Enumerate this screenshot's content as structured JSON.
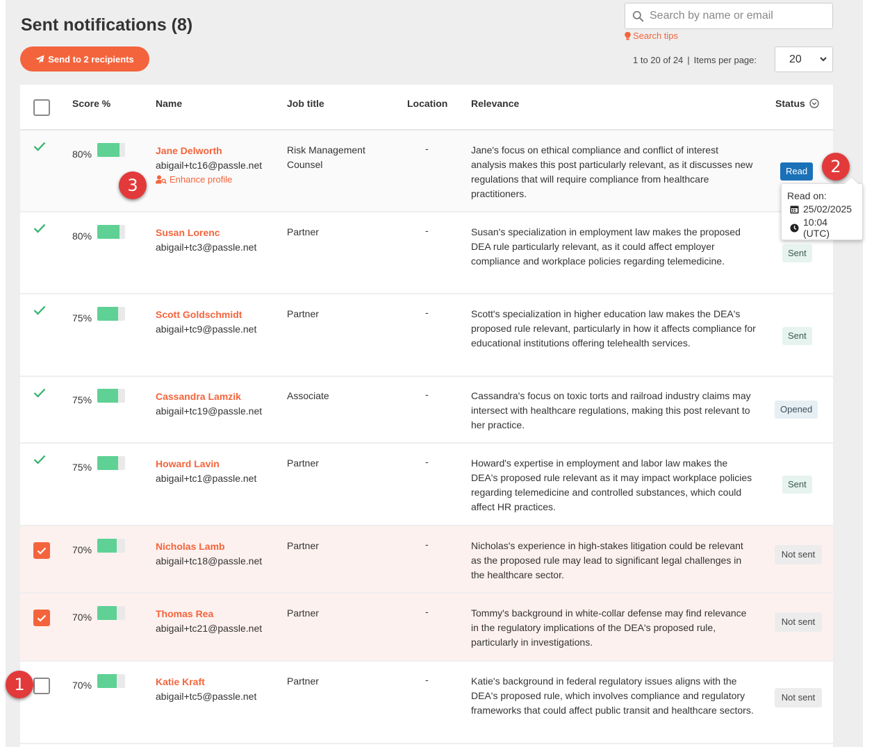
{
  "header": {
    "title": "Sent notifications (8)",
    "send_button": "Send to 2 recipients"
  },
  "search": {
    "placeholder": "Search by name or email",
    "tips": "Search tips"
  },
  "pagination": {
    "range": "1 to 20 of 24",
    "separator": "|",
    "items_per_page_label": "Items per page:",
    "items_per_page": "20"
  },
  "columns": {
    "score": "Score %",
    "name": "Name",
    "job": "Job title",
    "location": "Location",
    "relevance": "Relevance",
    "status": "Status"
  },
  "rows": [
    {
      "score": "80%",
      "score_fill": 0.8,
      "name": "Jane Delworth",
      "email": "abigail+tc16@passle.net",
      "job": "Risk Management Counsel",
      "location": "-",
      "relevance": "Jane's focus on ethical compliance and conflict of interest analysis makes this post particularly relevant, as it discusses new regulations that will require compliance from healthcare practitioners.",
      "status": "Read",
      "enhance": "Enhance profile"
    },
    {
      "score": "80%",
      "score_fill": 0.8,
      "name": "Susan Lorenc",
      "email": "abigail+tc3@passle.net",
      "job": "Partner",
      "location": "-",
      "relevance": "Susan's specialization in employment law makes the proposed DEA rule particularly relevant, as it could affect employer compliance and workplace policies regarding telemedicine.",
      "status": "Sent"
    },
    {
      "score": "75%",
      "score_fill": 0.75,
      "name": "Scott Goldschmidt",
      "email": "abigail+tc9@passle.net",
      "job": "Partner",
      "location": "-",
      "relevance": "Scott's specialization in higher education law makes the DEA's proposed rule relevant, particularly in how it affects compliance for educational institutions offering telehealth services.",
      "status": "Sent"
    },
    {
      "score": "75%",
      "score_fill": 0.75,
      "name": "Cassandra Lamzik",
      "email": "abigail+tc19@passle.net",
      "job": "Associate",
      "location": "-",
      "relevance": "Cassandra's focus on toxic torts and railroad industry claims may intersect with healthcare regulations, making this post relevant to her practice.",
      "status": "Opened"
    },
    {
      "score": "75%",
      "score_fill": 0.75,
      "name": "Howard Lavin",
      "email": "abigail+tc1@passle.net",
      "job": "Partner",
      "location": "-",
      "relevance": "Howard's expertise in employment and labor law makes the DEA's proposed rule relevant as it may impact workplace policies regarding telemedicine and controlled substances, which could affect HR practices.",
      "status": "Sent"
    },
    {
      "score": "70%",
      "score_fill": 0.7,
      "name": "Nicholas Lamb",
      "email": "abigail+tc18@passle.net",
      "job": "Partner",
      "location": "-",
      "relevance": "Nicholas's experience in high-stakes litigation could be relevant as the proposed rule may lead to significant legal challenges in the healthcare sector.",
      "status": "Not sent"
    },
    {
      "score": "70%",
      "score_fill": 0.7,
      "name": "Thomas Rea",
      "email": "abigail+tc21@passle.net",
      "job": "Partner",
      "location": "-",
      "relevance": "Tommy's background in white-collar defense may find relevance in the regulatory implications of the DEA's proposed rule, particularly in investigations.",
      "status": "Not sent"
    },
    {
      "score": "70%",
      "score_fill": 0.7,
      "name": "Katie Kraft",
      "email": "abigail+tc5@passle.net",
      "job": "Partner",
      "location": "-",
      "relevance": "Katie's background in federal regulatory issues aligns with the DEA's proposed rule, which involves compliance and regulatory frameworks that could affect public transit and healthcare sectors.",
      "status": "Not sent"
    }
  ],
  "tooltip": {
    "title": "Read on:",
    "date": "25/02/2025",
    "time": "10:04 (UTC)"
  },
  "markers": {
    "m1": "1",
    "m2": "2",
    "m3": "3"
  },
  "colors": {
    "accent": "#f4643c",
    "read": "#1a71b8",
    "score_bar": "#5fd195",
    "check": "#2fb36b",
    "marker": "#e23a3a"
  }
}
